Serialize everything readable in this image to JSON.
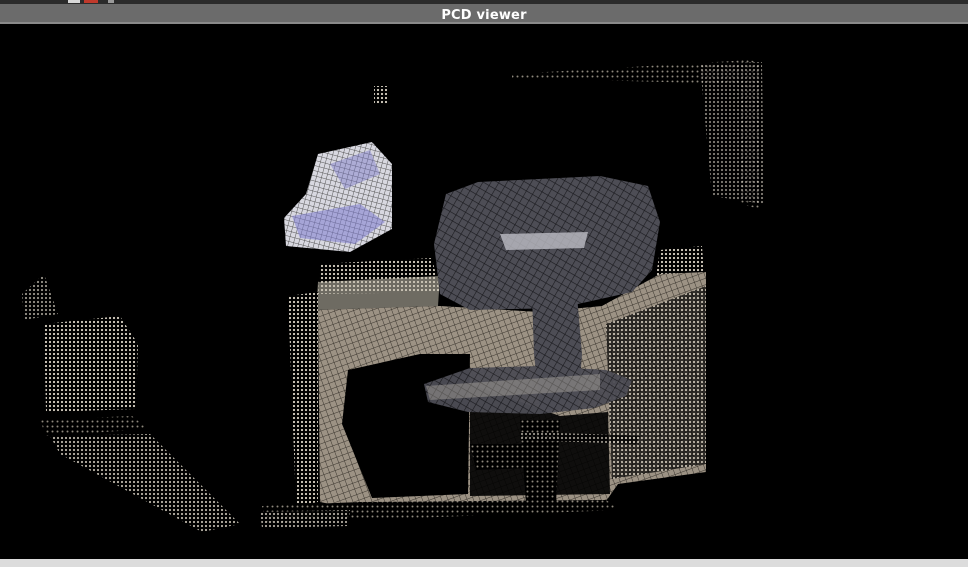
{
  "window": {
    "title": "PCD viewer"
  },
  "viewport": {
    "content": "point-cloud-render",
    "colors": {
      "background": "#000000",
      "chair_back": "#5a5a62",
      "desk_panel": "#9a8f80",
      "desk_top": "#c8c0b0",
      "blue_object": "#7a78c8",
      "points": "#d8d0c0"
    }
  }
}
